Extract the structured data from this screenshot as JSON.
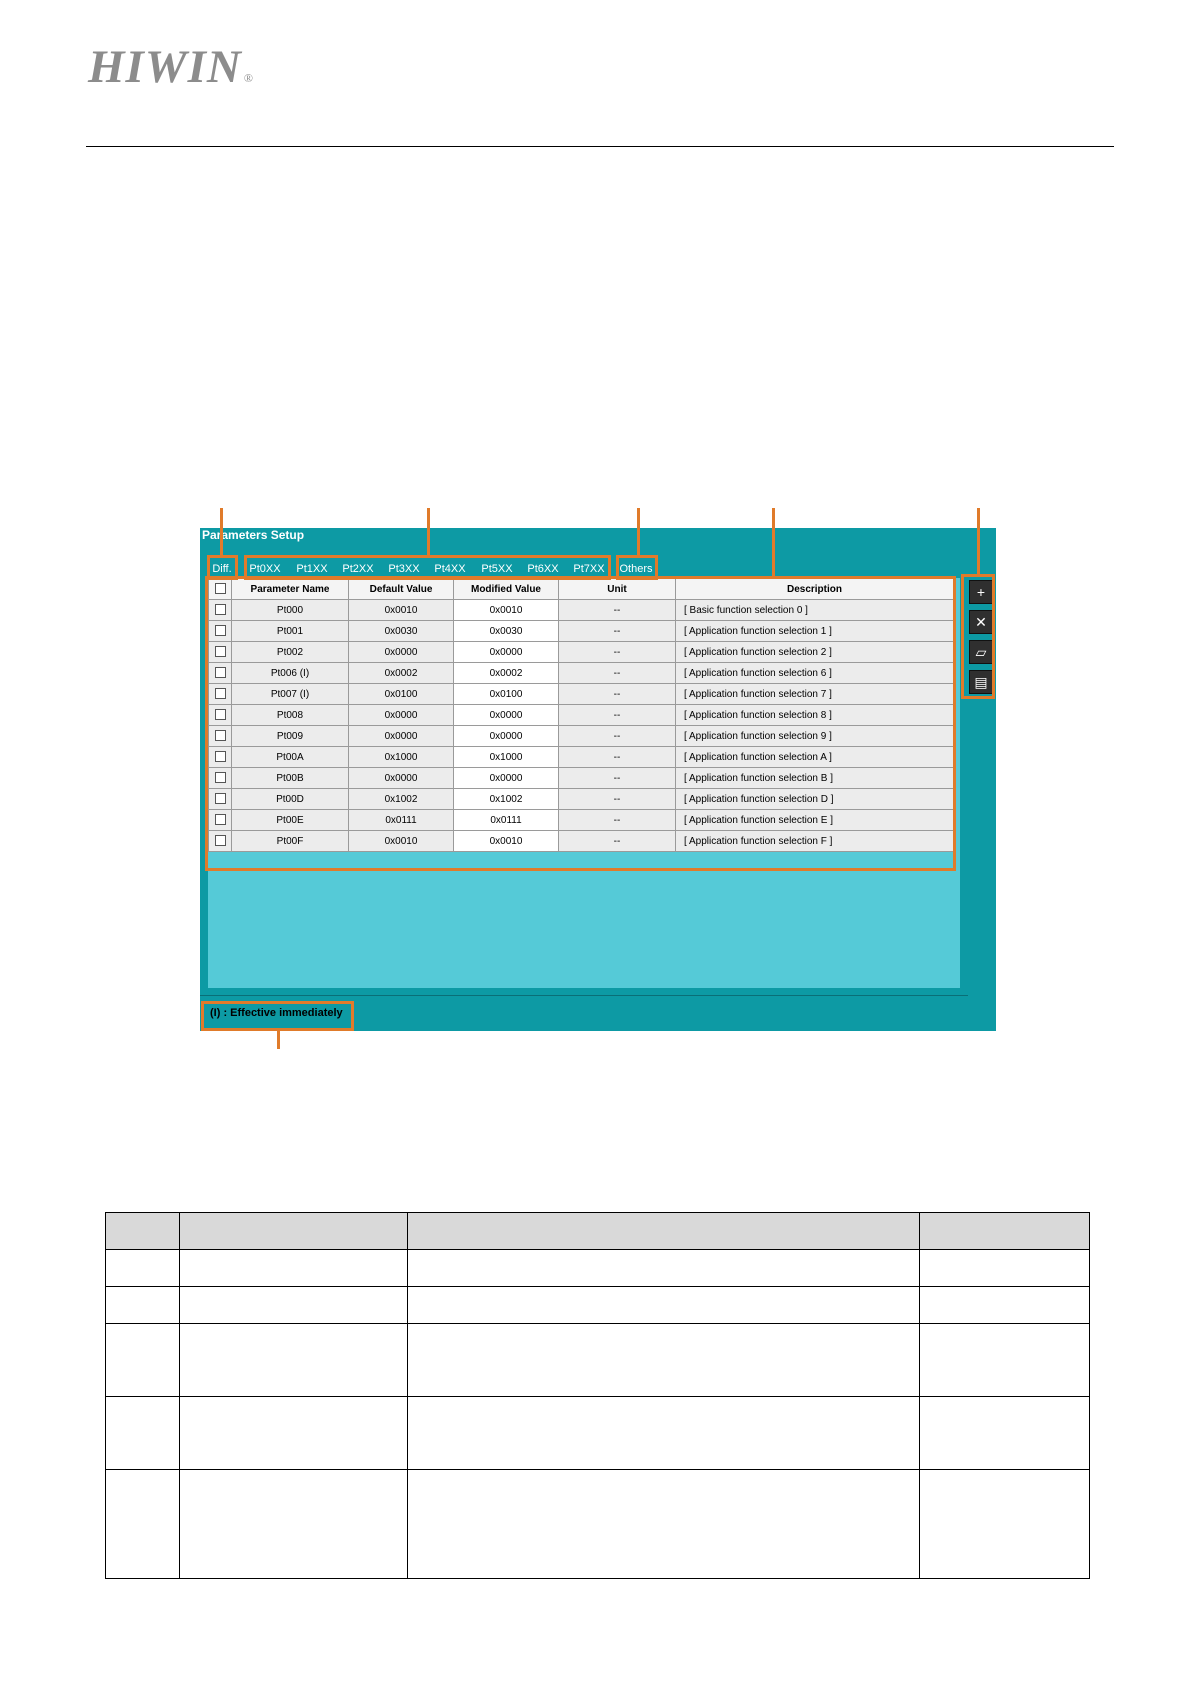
{
  "logo": {
    "text": "HIWIN",
    "mark": "®"
  },
  "window": {
    "title": "Parameters Setup",
    "diff_tab": "Diff.",
    "group_tabs": [
      "Pt0XX",
      "Pt1XX",
      "Pt2XX",
      "Pt3XX",
      "Pt4XX",
      "Pt5XX",
      "Pt6XX",
      "Pt7XX"
    ],
    "others_tab": "Others",
    "columns": [
      "Parameter Name",
      "Default Value",
      "Modified Value",
      "Unit",
      "Description"
    ],
    "rows": [
      {
        "name": "Pt000",
        "default": "0x0010",
        "modified": "0x0010",
        "unit": "--",
        "desc": "[ Basic function selection 0 ]"
      },
      {
        "name": "Pt001",
        "default": "0x0030",
        "modified": "0x0030",
        "unit": "--",
        "desc": "[ Application function selection 1 ]"
      },
      {
        "name": "Pt002",
        "default": "0x0000",
        "modified": "0x0000",
        "unit": "--",
        "desc": "[ Application function selection 2 ]"
      },
      {
        "name": "Pt006 (I)",
        "default": "0x0002",
        "modified": "0x0002",
        "unit": "--",
        "desc": "[ Application function selection 6 ]"
      },
      {
        "name": "Pt007 (I)",
        "default": "0x0100",
        "modified": "0x0100",
        "unit": "--",
        "desc": "[ Application function selection 7 ]"
      },
      {
        "name": "Pt008",
        "default": "0x0000",
        "modified": "0x0000",
        "unit": "--",
        "desc": "[ Application function selection 8 ]"
      },
      {
        "name": "Pt009",
        "default": "0x0000",
        "modified": "0x0000",
        "unit": "--",
        "desc": "[ Application function selection 9 ]"
      },
      {
        "name": "Pt00A",
        "default": "0x1000",
        "modified": "0x1000",
        "unit": "--",
        "desc": "[ Application function selection A ]"
      },
      {
        "name": "Pt00B",
        "default": "0x0000",
        "modified": "0x0000",
        "unit": "--",
        "desc": "[ Application function selection B ]"
      },
      {
        "name": "Pt00D",
        "default": "0x1002",
        "modified": "0x1002",
        "unit": "--",
        "desc": "[ Application function selection D ]"
      },
      {
        "name": "Pt00E",
        "default": "0x0111",
        "modified": "0x0111",
        "unit": "--",
        "desc": "[ Application function selection E ]"
      },
      {
        "name": "Pt00F",
        "default": "0x0010",
        "modified": "0x0010",
        "unit": "--",
        "desc": "[ Application function selection F ]"
      }
    ],
    "side_buttons": [
      {
        "icon": "add-icon",
        "glyph": "+"
      },
      {
        "icon": "delete-icon",
        "glyph": "✕"
      },
      {
        "icon": "open-folder-icon",
        "glyph": "▱"
      },
      {
        "icon": "save-icon",
        "glyph": "▤"
      }
    ],
    "footer": "(I) : Effective immediately"
  },
  "colors": {
    "window_bg": "#0d9aa4",
    "content_bg": "#55cad7",
    "highlight": "#e07b2a",
    "logo": "#8c8c8c"
  }
}
